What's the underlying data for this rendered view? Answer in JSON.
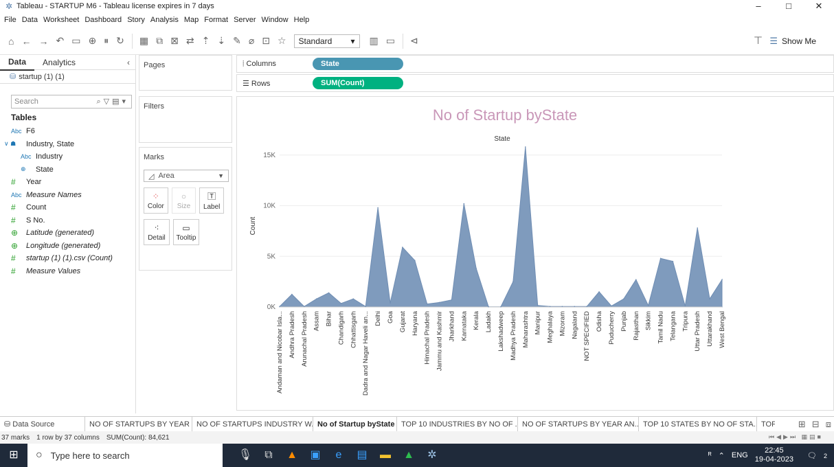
{
  "window": {
    "title": "Tableau - STARTUP M6 - Tableau license expires in 7 days",
    "controls": [
      "–",
      "□",
      "✕"
    ]
  },
  "menu": [
    "File",
    "Data",
    "Worksheet",
    "Dashboard",
    "Story",
    "Analysis",
    "Map",
    "Format",
    "Server",
    "Window",
    "Help"
  ],
  "toolbar": {
    "fit": "Standard",
    "show_me": "Show Me"
  },
  "data_pane": {
    "tabs": [
      "Data",
      "Analytics"
    ],
    "datasource": "startup (1) (1)",
    "search_placeholder": "Search",
    "tables_heading": "Tables",
    "fields": [
      {
        "type": "Abc",
        "label": "F6",
        "italic": false,
        "kind": "dim"
      },
      {
        "type": "∨ ☗",
        "label": "Industry, State",
        "italic": false,
        "kind": "hier"
      },
      {
        "type": "Abc",
        "label": "Industry",
        "italic": false,
        "kind": "dim",
        "indent": true
      },
      {
        "type": "⊕",
        "label": "State",
        "italic": false,
        "kind": "dim",
        "indent": true
      },
      {
        "type": "#",
        "label": "Year",
        "italic": false,
        "kind": "meas"
      },
      {
        "type": "Abc",
        "label": "Measure Names",
        "italic": true,
        "kind": "dim"
      },
      {
        "type": "#",
        "label": "Count",
        "italic": false,
        "kind": "meas"
      },
      {
        "type": "#",
        "label": "S No.",
        "italic": false,
        "kind": "meas"
      },
      {
        "type": "⊕",
        "label": "Latitude (generated)",
        "italic": true,
        "kind": "meas"
      },
      {
        "type": "⊕",
        "label": "Longitude (generated)",
        "italic": true,
        "kind": "meas"
      },
      {
        "type": "#",
        "label": "startup (1) (1).csv (Count)",
        "italic": true,
        "kind": "meas"
      },
      {
        "type": "#",
        "label": "Measure Values",
        "italic": true,
        "kind": "meas"
      }
    ]
  },
  "shelves": {
    "pages": "Pages",
    "filters": "Filters",
    "marks": "Marks",
    "mark_type": "Area",
    "mark_buttons": [
      "Color",
      "Size",
      "Label",
      "Detail",
      "Tooltip"
    ],
    "columns_label": "Columns",
    "rows_label": "Rows",
    "columns_pill": "State",
    "rows_pill": "SUM(Count)"
  },
  "chart_data": {
    "type": "area",
    "title": "No of Startup byState",
    "xlabel": "State",
    "ylabel": "Count",
    "ylim": [
      0,
      16000
    ],
    "yticks": [
      0,
      5000,
      10000,
      15000
    ],
    "ytick_labels": [
      "0K",
      "5K",
      "10K",
      "15K"
    ],
    "grid": true,
    "color": "#7f9bbd",
    "title_color": "#c997b8",
    "categories": [
      "Andaman and Nicobar Isla...",
      "Andhra Pradesh",
      "Arunachal Pradesh",
      "Assam",
      "Bihar",
      "Chandigarh",
      "Chhattisgarh",
      "Dadra and Nagar Haveli an...",
      "Delhi",
      "Goa",
      "Gujarat",
      "Haryana",
      "Himachal Pradesh",
      "Jammu and Kashmir",
      "Jharkhand",
      "Karnataka",
      "Kerala",
      "Ladakh",
      "Lakshadweep",
      "Madhya Pradesh",
      "Maharashtra",
      "Manipur",
      "Meghalaya",
      "Mizoram",
      "Nagaland",
      "NOT SPECIFIED",
      "Odisha",
      "Puducherry",
      "Punjab",
      "Rajasthan",
      "Sikkim",
      "Tamil Nadu",
      "Telangana",
      "Tripura",
      "Uttar Pradesh",
      "Uttarakhand",
      "West Bengal"
    ],
    "values": [
      50,
      1250,
      50,
      800,
      1400,
      350,
      800,
      50,
      9800,
      400,
      5900,
      4600,
      300,
      450,
      700,
      10200,
      3800,
      20,
      20,
      2500,
      15800,
      150,
      50,
      50,
      50,
      50,
      1500,
      100,
      800,
      2700,
      150,
      4800,
      4500,
      100,
      7800,
      800,
      2700
    ]
  },
  "sheet_tabs": {
    "data_source": "Data Source",
    "tabs": [
      "NO OF STARTUPS BY YEAR",
      "NO OF STARTUPS INDUSTRY W...",
      "No of Startup byState",
      "TOP 10 INDUSTRIES BY NO OF ...",
      "NO OF STARTUPS BY YEAR AN...",
      "TOP 10 STATES BY NO OF STA...",
      "TOF"
    ],
    "active_index": 2
  },
  "status": {
    "marks": "37 marks",
    "dims": "1 row by 37 columns",
    "sum": "SUM(Count): 84,621"
  },
  "taskbar": {
    "search_placeholder": "Type here to search",
    "lang": "ENG",
    "time": "22:45",
    "date": "19-04-2023",
    "notif_count": "2"
  }
}
